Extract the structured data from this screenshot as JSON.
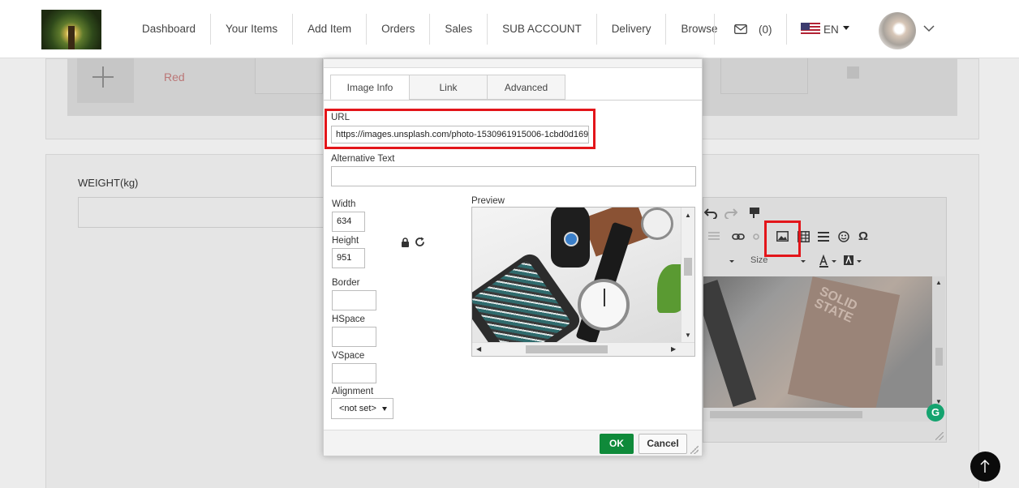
{
  "navbar": {
    "logo_alt": "Logo",
    "links": [
      "Dashboard",
      "Your Items",
      "Add Item",
      "Orders",
      "Sales",
      "SUB ACCOUNT",
      "Delivery",
      "Browse"
    ],
    "messages_count": "(0)",
    "language": "EN"
  },
  "background": {
    "variant_color": "Red",
    "weight_label": "WEIGHT(kg)",
    "editor": {
      "size_label": "Size",
      "image_title": "SOLID STATE",
      "grammarly_letter": "G"
    }
  },
  "dialog": {
    "tabs": [
      "Image Info",
      "Link",
      "Advanced"
    ],
    "active_tab": "Image Info",
    "url_label": "URL",
    "url_value": "https://images.unsplash.com/photo-1530961915006-1cbd0d169",
    "alt_text_label": "Alternative Text",
    "alt_text_value": "",
    "width_label": "Width",
    "width_value": "634",
    "height_label": "Height",
    "height_value": "951",
    "border_label": "Border",
    "border_value": "",
    "hspace_label": "HSpace",
    "hspace_value": "",
    "vspace_label": "VSpace",
    "vspace_value": "",
    "alignment_label": "Alignment",
    "alignment_value": "<not set>",
    "preview_label": "Preview",
    "ok_label": "OK",
    "cancel_label": "Cancel"
  },
  "colors": {
    "highlight": "#e3151a",
    "ok_button": "#0f8a3a"
  },
  "icons": [
    "mail-icon",
    "us-flag-icon",
    "chevron-down-icon",
    "lock-icon",
    "reset-size-icon",
    "image-icon",
    "table-icon",
    "smiley-icon",
    "omega-icon",
    "arrow-up-icon"
  ]
}
